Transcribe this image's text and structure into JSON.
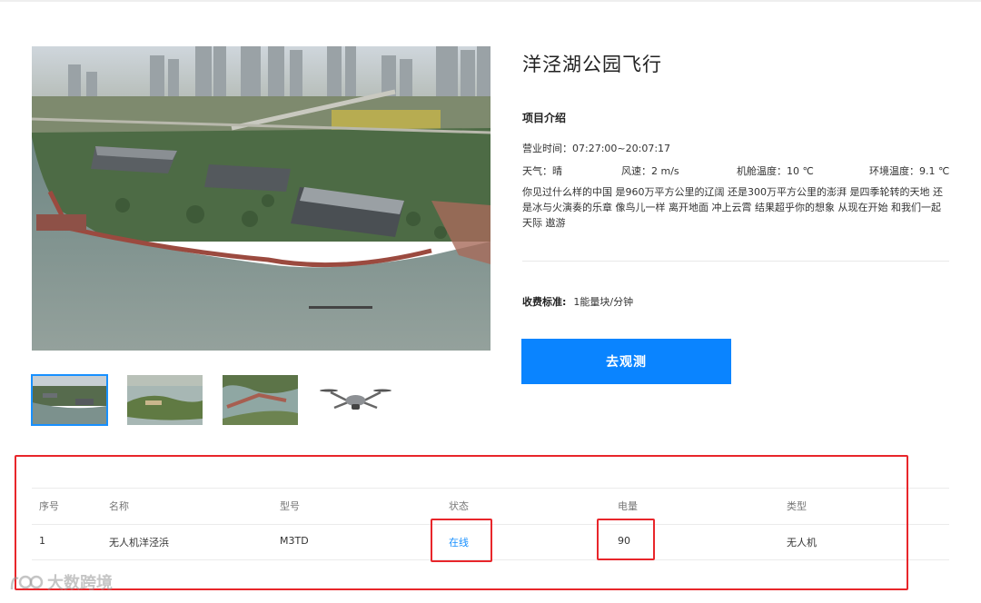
{
  "project": {
    "title": "洋泾湖公园飞行",
    "intro_heading": "项目介绍",
    "hours_label": "营业时间：",
    "hours_value": "07:27:00~20:07:17",
    "weather": "天气：晴",
    "wind": "风速：2 m/s",
    "cabin_temp": "机舱温度：10 ℃",
    "ambient_temp": "环境温度：9.1 ℃",
    "description": "你见过什么样的中国 是960万平方公里的辽阔 还是300万平方公里的澎湃 是四季轮转的天地 还是冰与火演奏的乐章 像鸟儿一样 离开地面 冲上云霄 结果超乎你的想象 从现在开始 和我们一起 天际 遨游",
    "fee_label": "收费标准:",
    "fee_value": "1能量块/分钟",
    "observe_button": "去观测"
  },
  "gallery": {
    "thumbnails": [
      "aerial-park-thumb",
      "island-thumb",
      "lake-thumb",
      "drone-thumb"
    ],
    "active_index": 0
  },
  "device_table": {
    "headers": [
      "序号",
      "名称",
      "型号",
      "状态",
      "电量",
      "类型"
    ],
    "rows": [
      [
        "1",
        "无人机洋泾浜",
        "M3TD",
        "在线",
        "90",
        "无人机"
      ]
    ]
  },
  "watermark": "大数跨境",
  "colors": {
    "accent": "#0a84ff",
    "status_online": "#1890ff",
    "annotation_red": "#e8262b"
  }
}
